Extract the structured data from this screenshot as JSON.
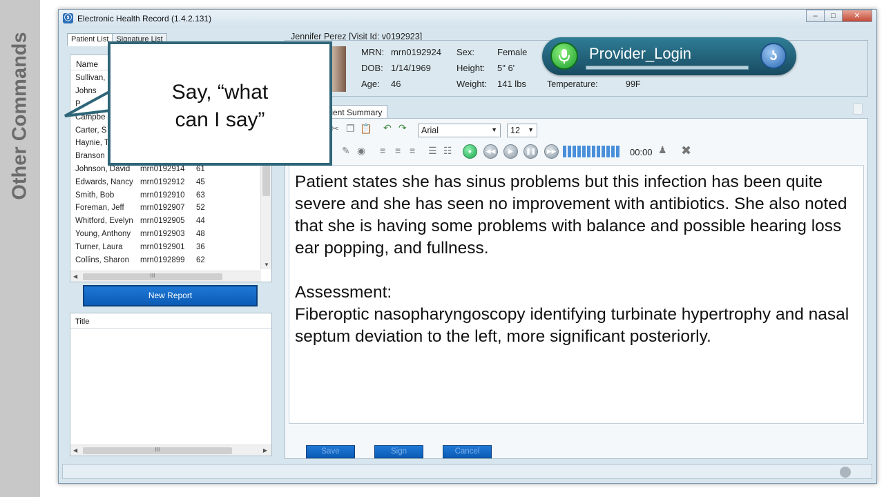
{
  "side": {
    "label": "Other Commands"
  },
  "window": {
    "title": "Electronic Health Record (1.4.2.131)",
    "minimize": "–",
    "maximize": "□",
    "close": "✕"
  },
  "left": {
    "tabs": [
      "Patient List",
      "Signature List"
    ],
    "list": {
      "header": "Name",
      "rows": [
        {
          "name": "Sullivan,",
          "mrn": "",
          "age": ""
        },
        {
          "name": "Johns",
          "mrn": "",
          "age": ""
        },
        {
          "name": "P",
          "mrn": "",
          "age": ""
        },
        {
          "name": "Campbe",
          "mrn": "",
          "age": ""
        },
        {
          "name": "Carter, S",
          "mrn": "",
          "age": ""
        },
        {
          "name": "Haynie, T",
          "mrn": "",
          "age": ""
        },
        {
          "name": "Branson",
          "mrn": "",
          "age": ""
        },
        {
          "name": "Johnson, David",
          "mrn": "mrn0192914",
          "age": "61"
        },
        {
          "name": "Edwards, Nancy",
          "mrn": "mrn0192912",
          "age": "45"
        },
        {
          "name": "Smith, Bob",
          "mrn": "mrn0192910",
          "age": "63"
        },
        {
          "name": "Foreman, Jeff",
          "mrn": "mrn0192907",
          "age": "52"
        },
        {
          "name": "Whitford, Evelyn",
          "mrn": "mrn0192905",
          "age": "44"
        },
        {
          "name": "Young, Anthony",
          "mrn": "mrn0192903",
          "age": "48"
        },
        {
          "name": "Turner, Laura",
          "mrn": "mrn0192901",
          "age": "36"
        },
        {
          "name": "Collins, Sharon",
          "mrn": "mrn0192899",
          "age": "62"
        }
      ]
    },
    "new_report": "New Report",
    "title_list_header": "Title",
    "scroll_grip": "III"
  },
  "patient": {
    "heading": "Jennifer Perez [Visit Id: v0192923]",
    "mrn_label": "MRN:",
    "mrn": "mrn0192924",
    "dob_label": "DOB:",
    "dob": "1/14/1969",
    "age_label": "Age:",
    "age": "46",
    "sex_label": "Sex:",
    "sex": "Female",
    "height_label": "Height:",
    "height": "5\" 6'",
    "weight_label": "Weight:",
    "weight": "141 lbs",
    "temp_label": "Temperature:",
    "temp": "99F"
  },
  "editor": {
    "tab": "tient Summary",
    "font": "Arial",
    "size": "12",
    "time": "00:00",
    "level_segments": 12,
    "paragraphs": [
      "Patient states she has sinus problems but this infection has been quite severe and she has seen no improvement with antibiotics. She also noted that she is having some problems with balance and possible hearing loss ear popping, and fullness.",
      "Assessment:",
      "Fiberoptic nasopharyngoscopy identifying turbinate hypertrophy and nasal septum deviation to the left, more significant posteriorly."
    ],
    "save": "Save",
    "sign": "Sign",
    "cancel": "Cancel"
  },
  "bubble": {
    "line1": "Say, “what",
    "line2": "can I say”"
  },
  "dragon": {
    "label": "Provider_Login"
  },
  "colors": {
    "accent": "#2f6578",
    "button_blue": "#0a5bb5",
    "dragon_bar": "#184b61"
  }
}
